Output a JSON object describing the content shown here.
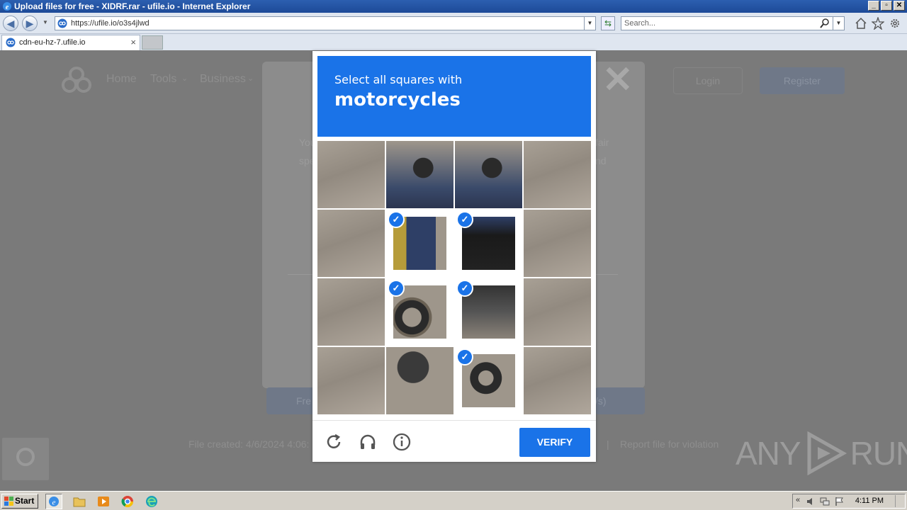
{
  "window": {
    "title": "Upload files for free - XIDRF.rar - ufile.io - Internet Explorer",
    "controls": [
      "_",
      "▫",
      "✕"
    ]
  },
  "browser": {
    "url": "https://ufile.io/o3s4jlwd",
    "search_placeholder": "Search...",
    "tabs": [
      {
        "label": "cdn-eu-hz-7.ufile.io",
        "close": "×"
      }
    ]
  },
  "site_background": {
    "nav": [
      "Home",
      "Tools",
      "Business"
    ],
    "login": "Login",
    "register": "Register",
    "modal_text_fragments": [
      "You",
      "spe",
      "fair",
      "nd"
    ],
    "bottom_left": "Fre",
    "bottom_right": "/s)",
    "file_created": "File created: 4/6/2024 4:06:",
    "separator": "|",
    "report": "Report file for violation",
    "close_glyph": "✕"
  },
  "captcha": {
    "subtitle": "Select all squares with",
    "object": "motorcycles",
    "verify_label": "VERIFY",
    "check_glyph": "✓",
    "selected": [
      [
        1,
        1
      ],
      [
        1,
        2
      ],
      [
        2,
        1
      ],
      [
        2,
        2
      ],
      [
        3,
        2
      ]
    ]
  },
  "watermark": {
    "text_left": "ANY",
    "text_right": "RUN"
  },
  "taskbar": {
    "start_label": "Start",
    "clock": "4:11 PM"
  },
  "colors": {
    "captcha_blue": "#1a73e8",
    "overlay": "#7a7a7a"
  }
}
